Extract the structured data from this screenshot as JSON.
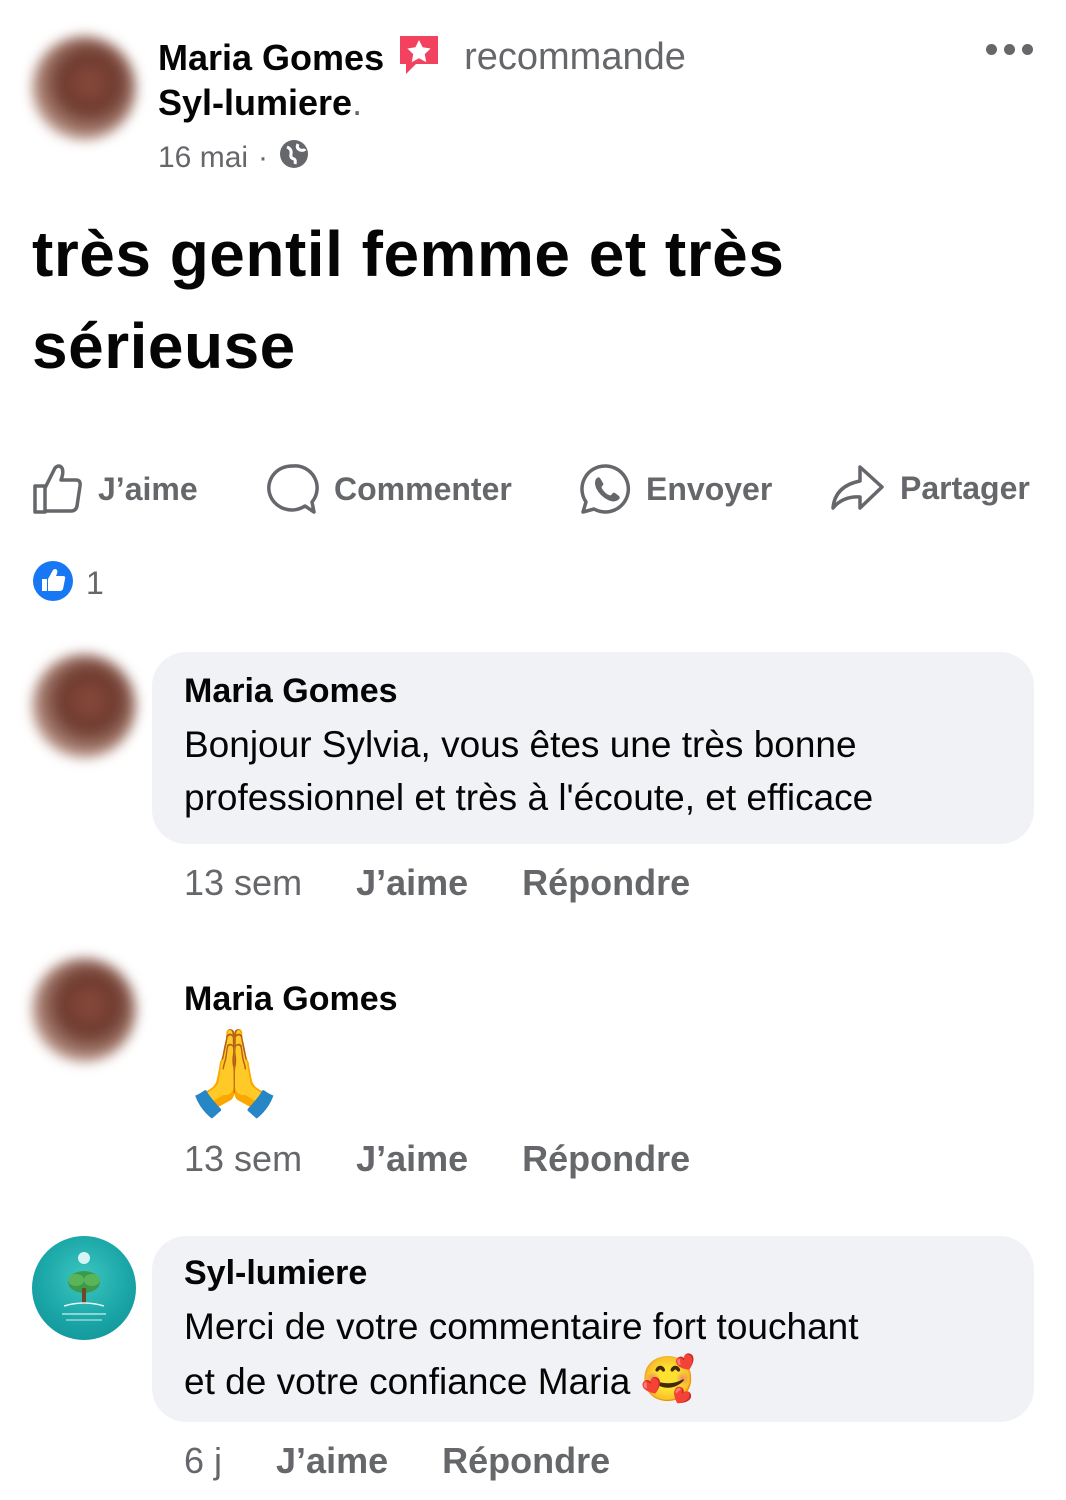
{
  "post": {
    "author": "Maria Gomes",
    "verb": "recommande",
    "page": "Syl-lumiere",
    "page_suffix": ".",
    "date": "16 mai",
    "separator": "·",
    "text_line1": "très gentil femme et très",
    "text_line2": "sérieuse"
  },
  "actions": {
    "like": "J’aime",
    "comment": "Commenter",
    "send": "Envoyer",
    "share": "Partager"
  },
  "reactions": {
    "count": "1"
  },
  "comments": [
    {
      "name": "Maria Gomes",
      "line1": "Bonjour Sylvia, vous êtes une très bonne",
      "line2": "professionnel et très à l'écoute, et efficace",
      "time": "13 sem",
      "like": "J’aime",
      "reply": "Répondre"
    },
    {
      "name": "Maria Gomes",
      "emoji": "🙏",
      "time": "13 sem",
      "like": "J’aime",
      "reply": "Répondre"
    },
    {
      "name": "Syl-lumiere",
      "line1": "Merci de votre commentaire fort touchant",
      "line2": "et de votre confiance Maria",
      "emoji": "🥰",
      "time": "6 j",
      "like": "J’aime",
      "reply": "Répondre"
    }
  ],
  "colors": {
    "text": "#050505",
    "muted": "#65676b",
    "bubble": "#f0f2f5",
    "like_blue": "#1877f2",
    "recommend_red": "#f3425f"
  }
}
